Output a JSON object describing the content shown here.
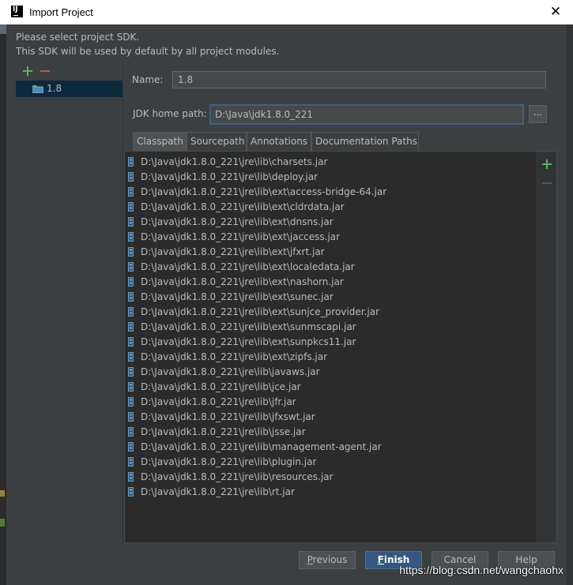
{
  "window": {
    "title": "Import Project",
    "close_glyph": "✕",
    "app_icon_letters": "IJ"
  },
  "header": {
    "line1": "Please select project SDK.",
    "line2": "This SDK will be used by default by all project modules."
  },
  "sdk_toolbar": {
    "add_icon": "plus-icon",
    "remove_icon": "minus-icon"
  },
  "sdk_list": {
    "items": [
      {
        "label": "1.8",
        "icon": "folder-icon",
        "selected": true
      }
    ]
  },
  "form": {
    "name_label": "Name:",
    "name_value": "1.8",
    "jdk_home_label": "JDK home path:",
    "jdk_home_value": "D:\\Java\\jdk1.8.0_221",
    "browse_label": "..."
  },
  "tabs": [
    {
      "label": "Classpath",
      "active": true
    },
    {
      "label": "Sourcepath",
      "active": false
    },
    {
      "label": "Annotations",
      "active": false
    },
    {
      "label": "Documentation Paths",
      "active": false
    }
  ],
  "classpath": [
    "D:\\Java\\jdk1.8.0_221\\jre\\lib\\charsets.jar",
    "D:\\Java\\jdk1.8.0_221\\jre\\lib\\deploy.jar",
    "D:\\Java\\jdk1.8.0_221\\jre\\lib\\ext\\access-bridge-64.jar",
    "D:\\Java\\jdk1.8.0_221\\jre\\lib\\ext\\cldrdata.jar",
    "D:\\Java\\jdk1.8.0_221\\jre\\lib\\ext\\dnsns.jar",
    "D:\\Java\\jdk1.8.0_221\\jre\\lib\\ext\\jaccess.jar",
    "D:\\Java\\jdk1.8.0_221\\jre\\lib\\ext\\jfxrt.jar",
    "D:\\Java\\jdk1.8.0_221\\jre\\lib\\ext\\localedata.jar",
    "D:\\Java\\jdk1.8.0_221\\jre\\lib\\ext\\nashorn.jar",
    "D:\\Java\\jdk1.8.0_221\\jre\\lib\\ext\\sunec.jar",
    "D:\\Java\\jdk1.8.0_221\\jre\\lib\\ext\\sunjce_provider.jar",
    "D:\\Java\\jdk1.8.0_221\\jre\\lib\\ext\\sunmscapi.jar",
    "D:\\Java\\jdk1.8.0_221\\jre\\lib\\ext\\sunpkcs11.jar",
    "D:\\Java\\jdk1.8.0_221\\jre\\lib\\ext\\zipfs.jar",
    "D:\\Java\\jdk1.8.0_221\\jre\\lib\\javaws.jar",
    "D:\\Java\\jdk1.8.0_221\\jre\\lib\\jce.jar",
    "D:\\Java\\jdk1.8.0_221\\jre\\lib\\jfr.jar",
    "D:\\Java\\jdk1.8.0_221\\jre\\lib\\jfxswt.jar",
    "D:\\Java\\jdk1.8.0_221\\jre\\lib\\jsse.jar",
    "D:\\Java\\jdk1.8.0_221\\jre\\lib\\management-agent.jar",
    "D:\\Java\\jdk1.8.0_221\\jre\\lib\\plugin.jar",
    "D:\\Java\\jdk1.8.0_221\\jre\\lib\\resources.jar",
    "D:\\Java\\jdk1.8.0_221\\jre\\lib\\rt.jar"
  ],
  "buttons": {
    "previous": "Previous",
    "finish": "Finish",
    "cancel": "Cancel",
    "help": "Help"
  },
  "watermark": "https://blog.csdn.net/wangchaohx",
  "colors": {
    "background": "#3c3f41",
    "list_background": "#2b2b2b",
    "text": "#bbbbbb",
    "selection": "#0d293e",
    "focus_border": "#3d6185",
    "primary_button": "#365880",
    "add_green": "#5fb157",
    "remove_red": "#c75450"
  }
}
